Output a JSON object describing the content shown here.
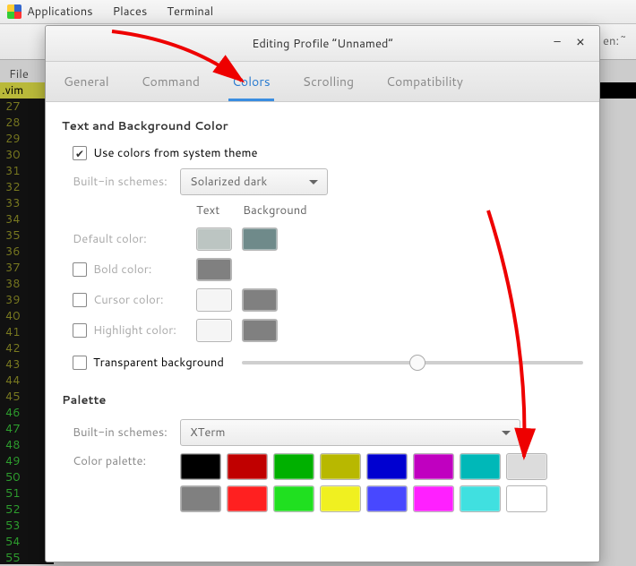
{
  "topbar": {
    "apps": "Applications",
    "places": "Places",
    "terminal": "Terminal"
  },
  "termwin": {
    "title_suffix": "en:~"
  },
  "file_btn": "File",
  "vim_header": ".vim",
  "gutter_lines": [
    "27",
    "28",
    "29",
    "30",
    "31",
    "32",
    "33",
    "34",
    "35",
    "36",
    "37",
    "38",
    "39",
    "40",
    "41",
    "42",
    "43",
    "44",
    "45",
    "46",
    "47",
    "48",
    "49",
    "50",
    "51",
    "52",
    "53",
    "54",
    "55"
  ],
  "gutter_green_from": 46,
  "dialog": {
    "title": "Editing Profile “Unnamed”",
    "tabs": {
      "general": "General",
      "command": "Command",
      "colors": "Colors",
      "scrolling": "Scrolling",
      "compat": "Compatibility",
      "active": "colors"
    }
  },
  "text_bg": {
    "section": "Text and Background Color",
    "use_system": "Use colors from system theme",
    "use_system_checked": true,
    "schemes_label": "Built-in schemes:",
    "scheme_value": "Solarized dark",
    "col_text": "Text",
    "col_bg": "Background",
    "default_lbl": "Default color:",
    "bold_lbl": "Bold color:",
    "cursor_lbl": "Cursor color:",
    "highlight_lbl": "Highlight color:",
    "transparent_lbl": "Transparent background",
    "swatches": {
      "default_text": "#bcc5c2",
      "default_bg": "#6f8a8a",
      "bold_text": "#808080",
      "cursor_text": "#f5f5f5",
      "cursor_bg": "#808080",
      "highlight_text": "#f5f5f5",
      "highlight_bg": "#808080"
    }
  },
  "palette": {
    "section": "Palette",
    "schemes_label": "Built-in schemes:",
    "scheme_value": "XTerm",
    "palette_lbl": "Color palette:",
    "colors_row1": [
      "#000000",
      "#c00000",
      "#00b000",
      "#b8b800",
      "#0000d0",
      "#c000c0",
      "#00b8b8",
      "#dcdcdc"
    ],
    "colors_row2": [
      "#808080",
      "#ff2020",
      "#20e020",
      "#f0f020",
      "#4848ff",
      "#ff20ff",
      "#40e0e0",
      "#ffffff"
    ]
  }
}
